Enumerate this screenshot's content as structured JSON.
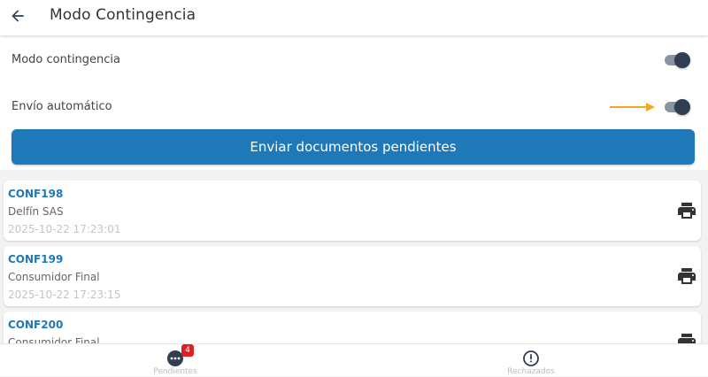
{
  "header": {
    "title": "Modo Contingencia",
    "back_icon": "arrow-left-icon"
  },
  "settings": {
    "items": [
      {
        "label": "Modo contingencia",
        "enabled": true
      },
      {
        "label": "Envío automático",
        "enabled": true
      }
    ]
  },
  "send_button": {
    "label": "Enviar documentos pendientes"
  },
  "documents": [
    {
      "id": "CONF198",
      "client": "Delfín SAS",
      "date": "2025-10-22 17:23:01"
    },
    {
      "id": "CONF199",
      "client": "Consumidor Final",
      "date": "2025-10-22 17:23:15"
    },
    {
      "id": "CONF200",
      "client": "Consumidor Final",
      "date": ""
    }
  ],
  "bottom_nav": {
    "items": [
      {
        "label": "Pendientes",
        "icon": "more-horiz-circle-icon",
        "badge": "4"
      },
      {
        "label": "Rechazados",
        "icon": "alert-circle-icon"
      }
    ]
  },
  "colors": {
    "accent": "#1f78b8",
    "switch_thumb": "#2f3e50",
    "switch_track": "#8b95a1",
    "annotation_arrow": "#f5a623",
    "badge": "#e02020"
  }
}
